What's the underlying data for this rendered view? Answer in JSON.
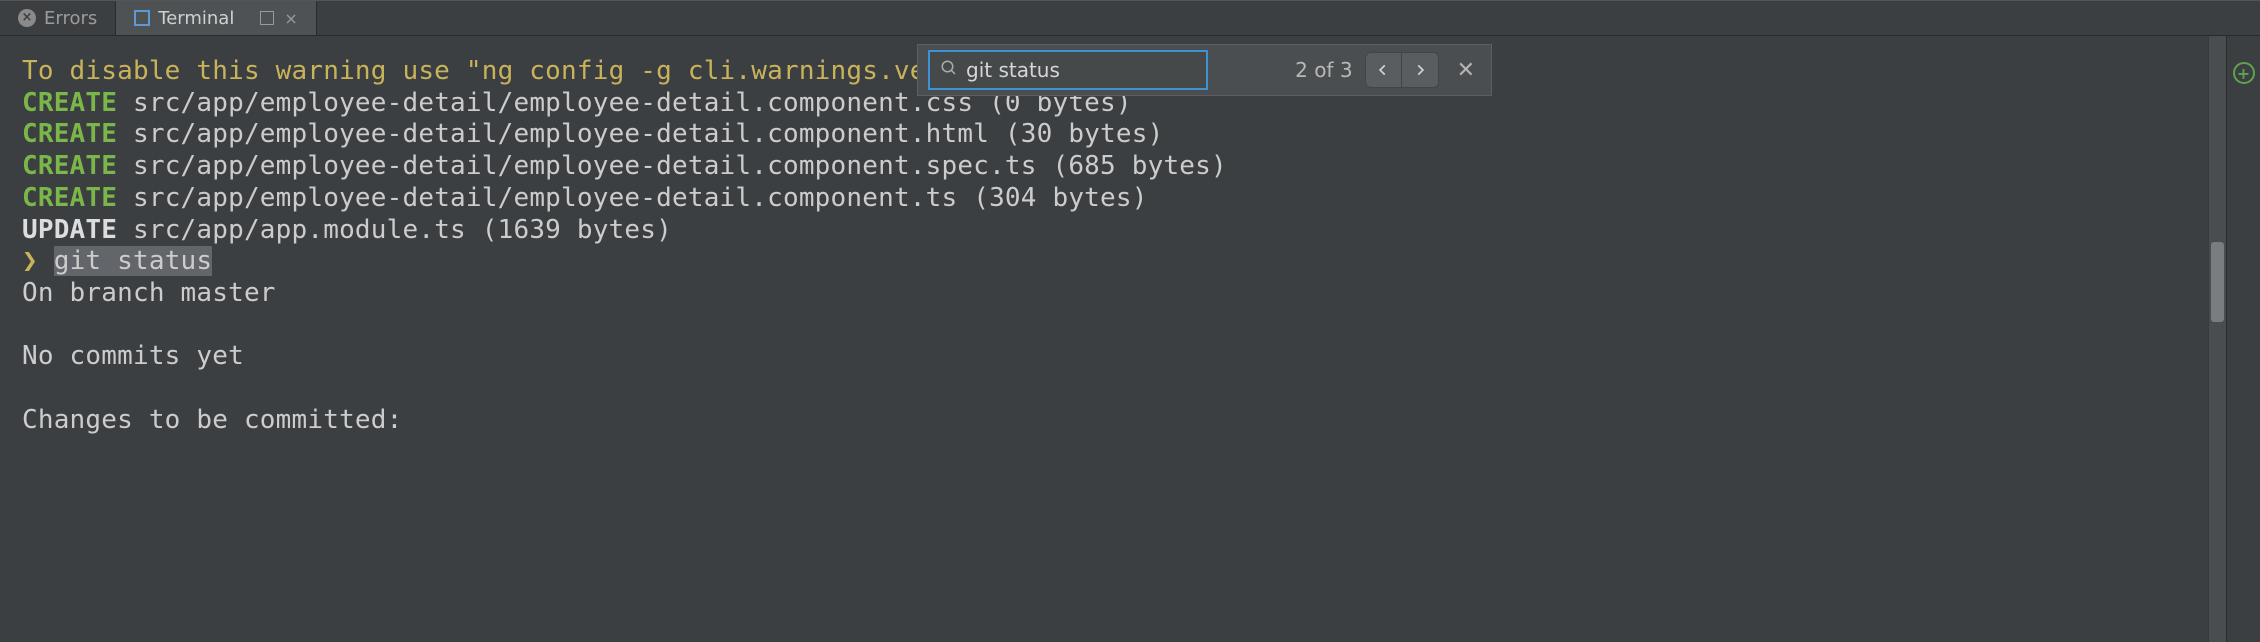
{
  "tabs": {
    "errors": {
      "label": "Errors"
    },
    "terminal": {
      "label": "Terminal"
    }
  },
  "find": {
    "query": "git status",
    "match_counter": "2 of 3"
  },
  "terminal": {
    "lines": [
      {
        "type": "warn",
        "text": "To disable this warning use \"ng config -g cli.warnings.versionMismatch false\"."
      },
      {
        "type": "create",
        "prefix": "CREATE",
        "path": "src/app/employee-detail/employee-detail.component.css (0 bytes)"
      },
      {
        "type": "create",
        "prefix": "CREATE",
        "path": "src/app/employee-detail/employee-detail.component.html (30 bytes)"
      },
      {
        "type": "create",
        "prefix": "CREATE",
        "path": "src/app/employee-detail/employee-detail.component.spec.ts (685 bytes)"
      },
      {
        "type": "create",
        "prefix": "CREATE",
        "path": "src/app/employee-detail/employee-detail.component.ts (304 bytes)"
      },
      {
        "type": "update",
        "prefix": "UPDATE",
        "path": "src/app/app.module.ts (1639 bytes)"
      },
      {
        "type": "prompt",
        "symbol": "❯",
        "command": "git status"
      },
      {
        "type": "plain",
        "text": "On branch master"
      },
      {
        "type": "blank",
        "text": ""
      },
      {
        "type": "plain",
        "text": "No commits yet"
      },
      {
        "type": "blank",
        "text": ""
      },
      {
        "type": "plain",
        "text": "Changes to be committed:"
      }
    ]
  },
  "colors": {
    "bg": "#3c3f41",
    "yellow": "#c9b35a",
    "green": "#7ab648",
    "accent": "#3b93d4"
  }
}
